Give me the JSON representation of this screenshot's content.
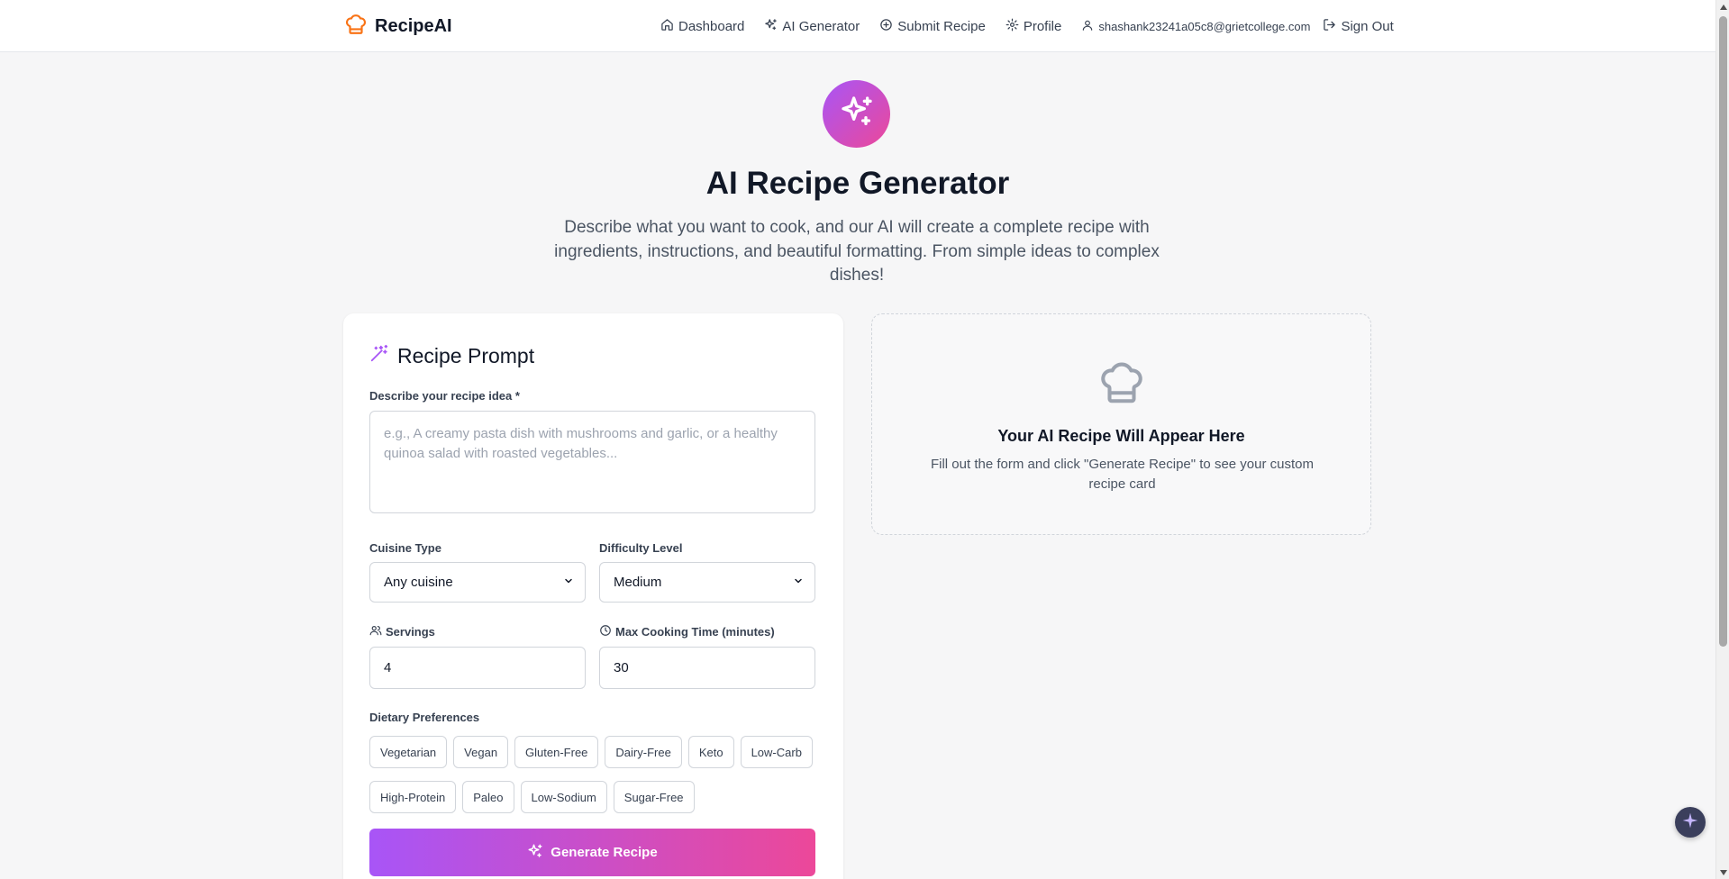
{
  "header": {
    "brand": "RecipeAI",
    "nav": {
      "dashboard": "Dashboard",
      "ai_generator": "AI Generator",
      "submit_recipe": "Submit Recipe",
      "profile": "Profile",
      "user_email": "shashank23241a05c8@grietcollege.com",
      "sign_out": "Sign Out"
    }
  },
  "hero": {
    "title": "AI Recipe Generator",
    "description": "Describe what you want to cook, and our AI will create a complete recipe with ingredients, instructions, and beautiful formatting. From simple ideas to complex dishes!"
  },
  "form": {
    "title": "Recipe Prompt",
    "prompt_label": "Describe your recipe idea *",
    "prompt_placeholder": "e.g., A creamy pasta dish with mushrooms and garlic, or a healthy quinoa salad with roasted vegetables...",
    "cuisine_label": "Cuisine Type",
    "cuisine_value": "Any cuisine",
    "difficulty_label": "Difficulty Level",
    "difficulty_value": "Medium",
    "servings_label": "Servings",
    "servings_value": "4",
    "time_label": "Max Cooking Time (minutes)",
    "time_value": "30",
    "dietary_label": "Dietary Preferences",
    "dietary_options": [
      "Vegetarian",
      "Vegan",
      "Gluten-Free",
      "Dairy-Free",
      "Keto",
      "Low-Carb",
      "High-Protein",
      "Paleo",
      "Low-Sodium",
      "Sugar-Free"
    ],
    "generate_button": "Generate Recipe"
  },
  "preview": {
    "title": "Your AI Recipe Will Appear Here",
    "description": "Fill out the form and click \"Generate Recipe\" to see your custom recipe card"
  },
  "colors": {
    "accent_start": "#a855f7",
    "accent_end": "#ec4899",
    "brand_icon": "#f97316"
  }
}
